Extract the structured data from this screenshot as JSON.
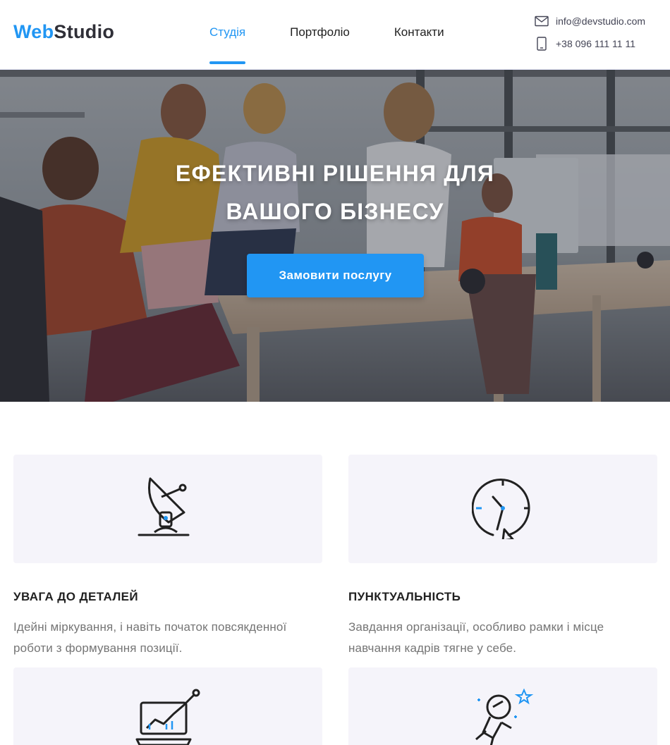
{
  "header": {
    "logo": {
      "part1": "Web",
      "part2": "Studio"
    },
    "nav": [
      {
        "label": "Студія",
        "active": true
      },
      {
        "label": "Портфоліо",
        "active": false
      },
      {
        "label": "Контакти",
        "active": false
      }
    ],
    "contacts": {
      "email": "info@devstudio.com",
      "phone": "+38 096 111 11 11",
      "email_icon": "mail-icon",
      "phone_icon": "smartphone-icon"
    }
  },
  "hero": {
    "title_line1": "Ефективні рішення для",
    "title_line2": "вашого бізнесу",
    "button": "Замовити послугу"
  },
  "features": [
    {
      "icon": "satellite-dish-icon",
      "title": "Увага до деталей",
      "text_line1": "Ідейні міркування, і навіть початок повсякденної",
      "text_line2": "роботи з формування позиції."
    },
    {
      "icon": "clock-icon",
      "title": "Пунктуальність",
      "text_line1": "Завдання організації, особливо рамки і місце",
      "text_line2": "навчання кадрів тягне у себе."
    },
    {
      "icon": "monitor-chart-icon",
      "title": "",
      "text_line1": "",
      "text_line2": ""
    },
    {
      "icon": "astronaut-icon",
      "title": "",
      "text_line1": "",
      "text_line2": ""
    }
  ],
  "colors": {
    "accent": "#2196f3",
    "dark": "#212121",
    "muted": "#757575",
    "card_bg": "#f5f4fa"
  }
}
